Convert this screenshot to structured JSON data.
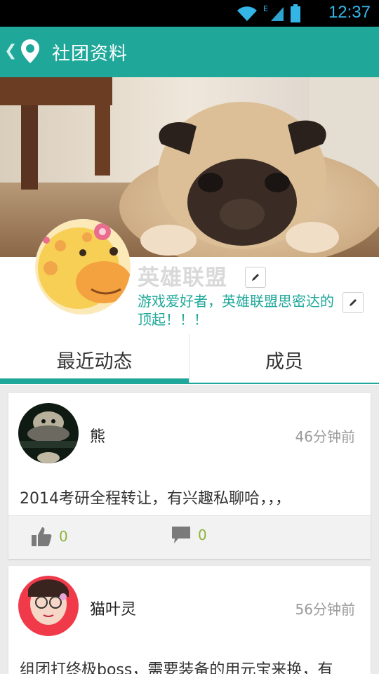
{
  "status_bar": {
    "time": "12:37",
    "network_label": "E",
    "icons": [
      "wifi-icon",
      "signal-icon",
      "battery-icon"
    ]
  },
  "header": {
    "title": "社团资料",
    "icons": [
      "back-chevron-icon",
      "location-pin-icon"
    ]
  },
  "club": {
    "name": "英雄联盟",
    "description": "游戏爱好者，英雄联盟思密达的顶起！！！"
  },
  "tabs": [
    {
      "label": "最近动态",
      "active": true
    },
    {
      "label": "成员",
      "active": false
    }
  ],
  "posts": [
    {
      "user": "熊",
      "time": "46分钟前",
      "text": "2014考研全程转让，有兴趣私聊哈，，，",
      "likes": "0",
      "comments": "0"
    },
    {
      "user": "猫叶灵",
      "time": "56分钟前",
      "text": "组团打终极boss，需要装备的用元宝来换，有"
    }
  ],
  "colors": {
    "accent": "#1fa89a",
    "status_blue": "#33b5e5",
    "count_green": "#8cb33a"
  }
}
